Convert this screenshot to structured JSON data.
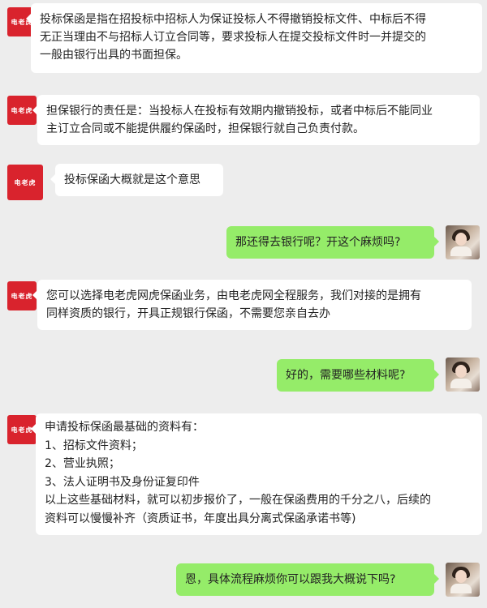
{
  "brand_avatar_text": "电老虎",
  "messages": [
    {
      "side": "left",
      "lines": [
        "投标保函是指在招投标中招标人为保证投标人不得撤销投标文件、中标后不得",
        "无正当理由不与招标人订立合同等，要求投标人在提交投标文件时一并提交的",
        "一般由银行出具的书面担保。"
      ]
    },
    {
      "side": "left",
      "lines": [
        "担保银行的责任是：当投标人在投标有效期内撤销投标，或者中标后不能同业",
        "主订立合同或不能提供履约保函时，担保银行就自己负责付款。"
      ]
    },
    {
      "side": "left",
      "lines": [
        "投标保函大概就是这个意思"
      ]
    },
    {
      "side": "right",
      "lines": [
        "那还得去银行呢？开这个麻烦吗?"
      ]
    },
    {
      "side": "left",
      "lines": [
        "您可以选择电老虎网虎保函业务，由电老虎网全程服务，我们对接的是拥有",
        "同样资质的银行，开具正规银行保函，不需要您亲自去办"
      ]
    },
    {
      "side": "right",
      "lines": [
        "好的，需要哪些材料呢?"
      ]
    },
    {
      "side": "left",
      "lines": [
        "申请投标保函最基础的资料有：",
        "1、招标文件资料；",
        "2、营业执照；",
        "3、法人证明书及身份证复印件",
        "以上这些基础材料，就可以初步报价了，一般在保函费用的千分之八，后续的",
        "资料可以慢慢补齐（资质证书，年度出具分离式保函承诺书等)"
      ]
    },
    {
      "side": "right",
      "lines": [
        "恩，具体流程麻烦你可以跟我大概说下吗?"
      ]
    }
  ],
  "colors": {
    "background": "#ededed",
    "left_bubble": "#ffffff",
    "right_bubble": "#95ec69",
    "brand": "#d9232d"
  }
}
